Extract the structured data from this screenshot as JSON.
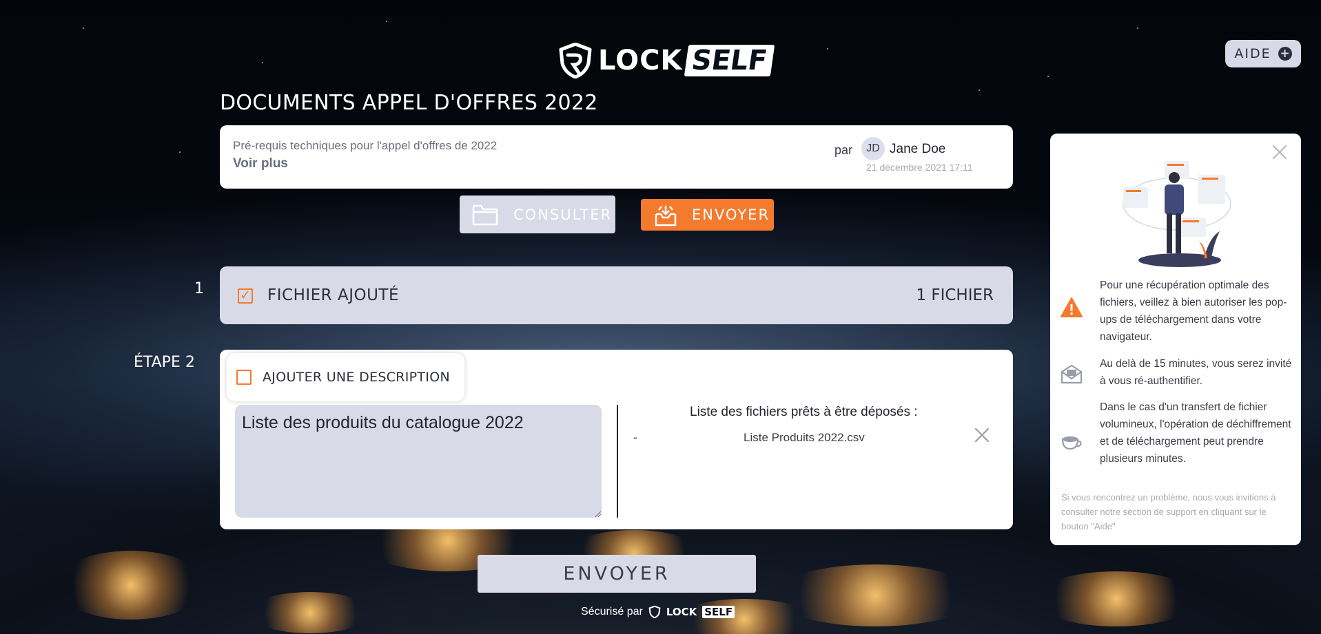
{
  "header": {
    "logo_lock": "LOCK",
    "logo_self": "SELF",
    "help_label": "AIDE",
    "help_icon": "plus-icon"
  },
  "page_title": "DOCUMENTS APPEL D'OFFRES 2022",
  "info": {
    "description": "Pré-requis techniques pour l'appel d'offres de 2022",
    "see_more": "Voir plus",
    "by_label": "par",
    "avatar_initials": "JD",
    "author": "Jane Doe",
    "date": "21 décembre 2021 17:11"
  },
  "modes": {
    "consult_label": "CONSULTER",
    "consult_icon": "folder-icon",
    "send_label": "ENVOYER",
    "send_icon": "inbox-upload-icon"
  },
  "step1": {
    "number": "1",
    "label": "FICHIER AJOUTÉ",
    "count": "1 FICHIER",
    "checked": true
  },
  "step2": {
    "number": "ÉTAPE 2",
    "toggle_label": "AJOUTER UNE DESCRIPTION",
    "checked": false,
    "description_value": "Liste des produits du catalogue 2022",
    "files_title": "Liste des fichiers prêts à être déposés :",
    "files": [
      {
        "dash": "-",
        "name": "Liste Produits 2022.csv"
      }
    ]
  },
  "submit_label": "ENVOYER",
  "footer": {
    "secured_by": "Sécurisé par",
    "lock": "LOCK",
    "self": "SELF"
  },
  "side_panel": {
    "tips": [
      {
        "icon": "warning-icon",
        "text": "Pour une récupération optimale des fichiers, veillez à bien autoriser les pop-ups de téléchargement dans votre navigateur."
      },
      {
        "icon": "envelope-icon",
        "text": "Au delà de 15 minutes, vous serez invité à vous ré-authentifier."
      },
      {
        "icon": "coffee-cup-icon",
        "text": "Dans le cas d'un transfert de fichier volumineux, l'opération de déchiffrement et de téléchargement peut prendre plusieurs minutes."
      }
    ],
    "footer_note": "Si vous rencontrez un problème, nous vous invitions à consulter notre section de support en cliquant sur le bouton \"Aide\""
  },
  "colors": {
    "accent": "#f47a2e",
    "panel": "#d9dae8",
    "text_dark": "#2c2f3a"
  }
}
